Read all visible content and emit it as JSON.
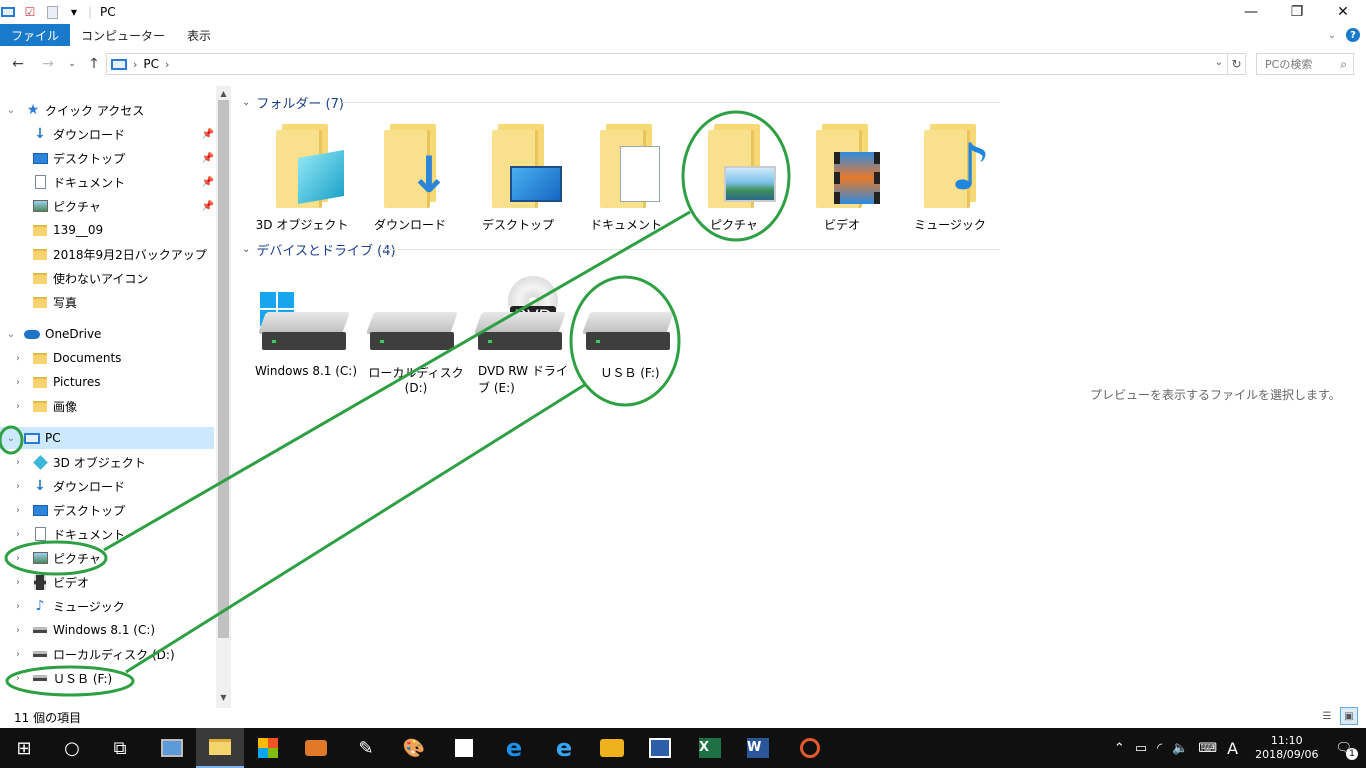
{
  "window": {
    "title": "PC"
  },
  "ribbon": {
    "tabs": [
      "ファイル",
      "コンピューター",
      "表示"
    ]
  },
  "address": {
    "segments": [
      "PC"
    ],
    "search_placeholder": "PCの検索"
  },
  "nav": {
    "quick_access": "クイック アクセス",
    "quick_items": [
      "ダウンロード",
      "デスクトップ",
      "ドキュメント",
      "ピクチャ",
      "139__09",
      "2018年9月2日バックアップ",
      "使わないアイコン",
      "写真"
    ],
    "onedrive": "OneDrive",
    "onedrive_items": [
      "Documents",
      "Pictures",
      "画像"
    ],
    "pc": "PC",
    "pc_items": [
      "3D オブジェクト",
      "ダウンロード",
      "デスクトップ",
      "ドキュメント",
      "ピクチャ",
      "ビデオ",
      "ミュージック",
      "Windows 8.1 (C:)",
      "ローカルディスク (D:)",
      "ＵＳＢ (F:)"
    ]
  },
  "content": {
    "folders_header": "フォルダー (7)",
    "folders": [
      "3D オブジェクト",
      "ダウンロード",
      "デスクトップ",
      "ドキュメント",
      "ピクチャ",
      "ビデオ",
      "ミュージック"
    ],
    "devices_header": "デバイスとドライブ (4)",
    "drives": [
      "Windows 8.1 (C:)",
      "ローカルディスク (D:)",
      "DVD RW ドライブ (E:)",
      "ＵＳＢ (F:)"
    ],
    "dvd_badge": "DVD",
    "preview": "プレビューを表示するファイルを選択します。"
  },
  "status": {
    "count": "11 個の項目"
  },
  "taskbar": {
    "time": "11:10",
    "date": "2018/09/06",
    "ime": "A",
    "notify_count": "1"
  },
  "colors": {
    "annotation": "#2ea043",
    "accent": "#1979ca",
    "taskbar": "#101010"
  }
}
